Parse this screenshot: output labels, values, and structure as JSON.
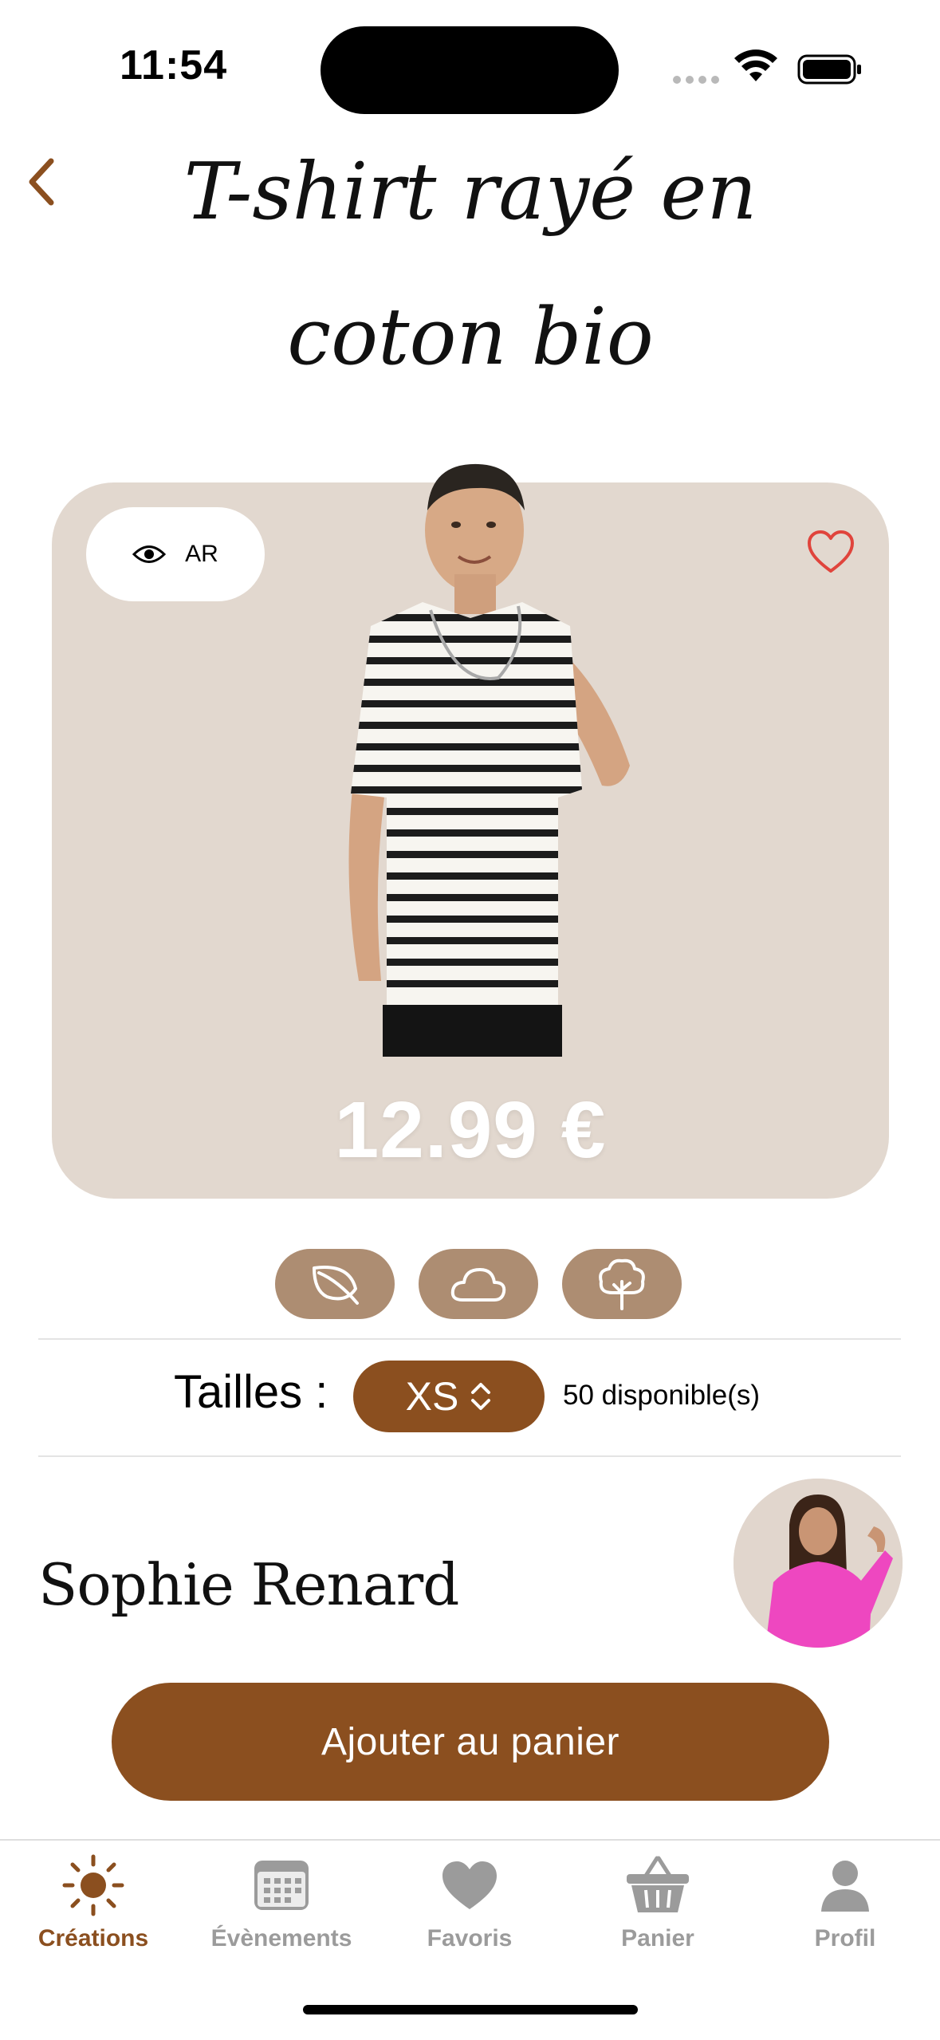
{
  "status_bar": {
    "time": "11:54"
  },
  "nav": {
    "back_icon": "chevron-left-icon"
  },
  "product": {
    "title": "T-shirt rayé en coton bio",
    "ar_label": "AR",
    "price": "12.99 €",
    "favorite_icon": "heart-outline-icon",
    "eco_badges": [
      "leaf-icon",
      "cloud-icon",
      "tree-icon"
    ]
  },
  "sizes": {
    "label": "Tailles :",
    "selected": "XS",
    "stock": "50 disponible(s)"
  },
  "seller": {
    "name": "Sophie Renard"
  },
  "cta": {
    "label": "Ajouter au panier"
  },
  "tabbar": {
    "items": [
      {
        "label": "Créations",
        "icon": "sun-icon",
        "active": true
      },
      {
        "label": "Évènements",
        "icon": "calendar-icon",
        "active": false
      },
      {
        "label": "Favoris",
        "icon": "heart-icon",
        "active": false
      },
      {
        "label": "Panier",
        "icon": "basket-icon",
        "active": false
      },
      {
        "label": "Profil",
        "icon": "person-icon",
        "active": false
      }
    ]
  },
  "colors": {
    "accent": "#8b4f1f",
    "card_bg": "#e2d8cf",
    "badge_bg": "#ad8d72",
    "heart": "#e0443c",
    "inactive": "#9b9b9b"
  }
}
